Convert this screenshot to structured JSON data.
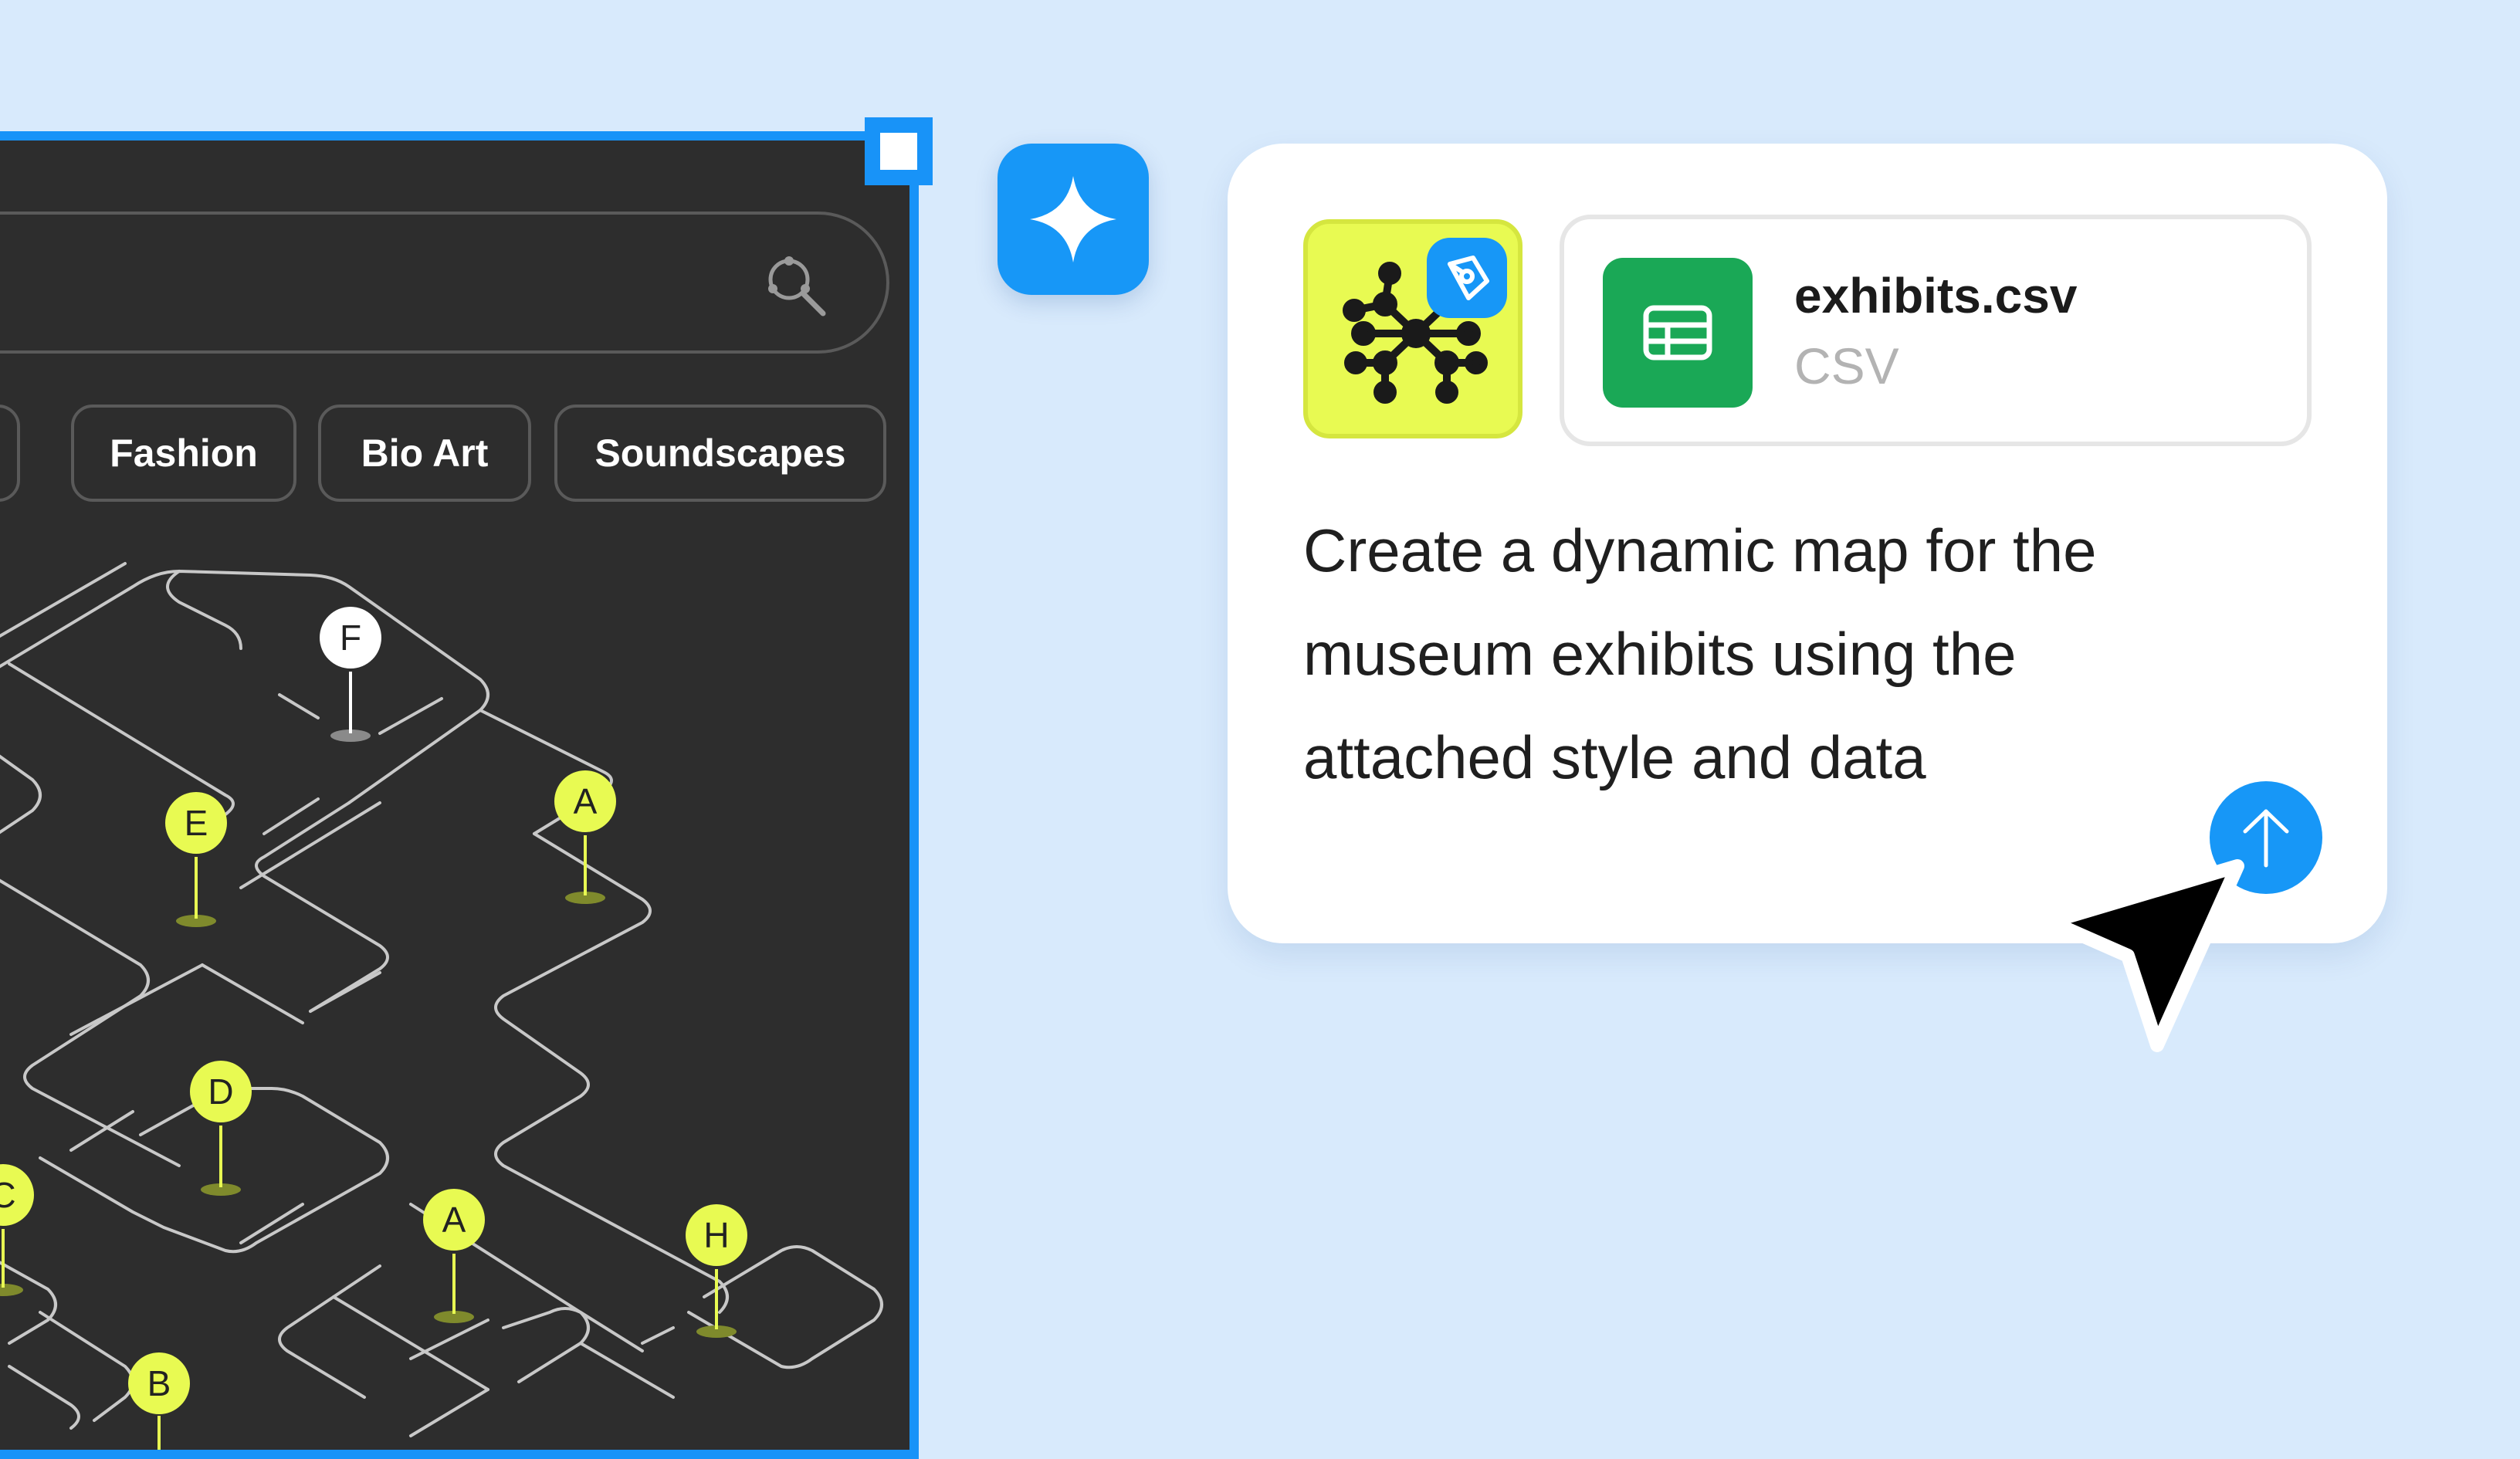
{
  "map_panel": {
    "chips": [
      "Fashion",
      "Bio Art",
      "Soundscapes"
    ],
    "pins": [
      "F",
      "E",
      "A",
      "D",
      "C",
      "A",
      "H",
      "B"
    ],
    "colors": {
      "background": "#2d2d2d",
      "pin_active": "#e8fa52",
      "pin_inactive": "#ffffff",
      "frame": "#1893f8"
    }
  },
  "ai_button": {
    "icon": "sparkle-icon"
  },
  "prompt_card": {
    "style_thumbnail": {
      "icon": "network-nodes-icon",
      "badge_icon": "pen-nib-icon"
    },
    "attachment": {
      "name": "exhibits.csv",
      "type": "CSV",
      "icon": "spreadsheet-icon"
    },
    "prompt_lines": [
      "Create a dynamic map for the",
      "museum exhibits using the",
      "attached style and data"
    ],
    "send_icon": "arrow-up-icon"
  },
  "cursor": {
    "icon": "pointer-arrow-icon"
  }
}
